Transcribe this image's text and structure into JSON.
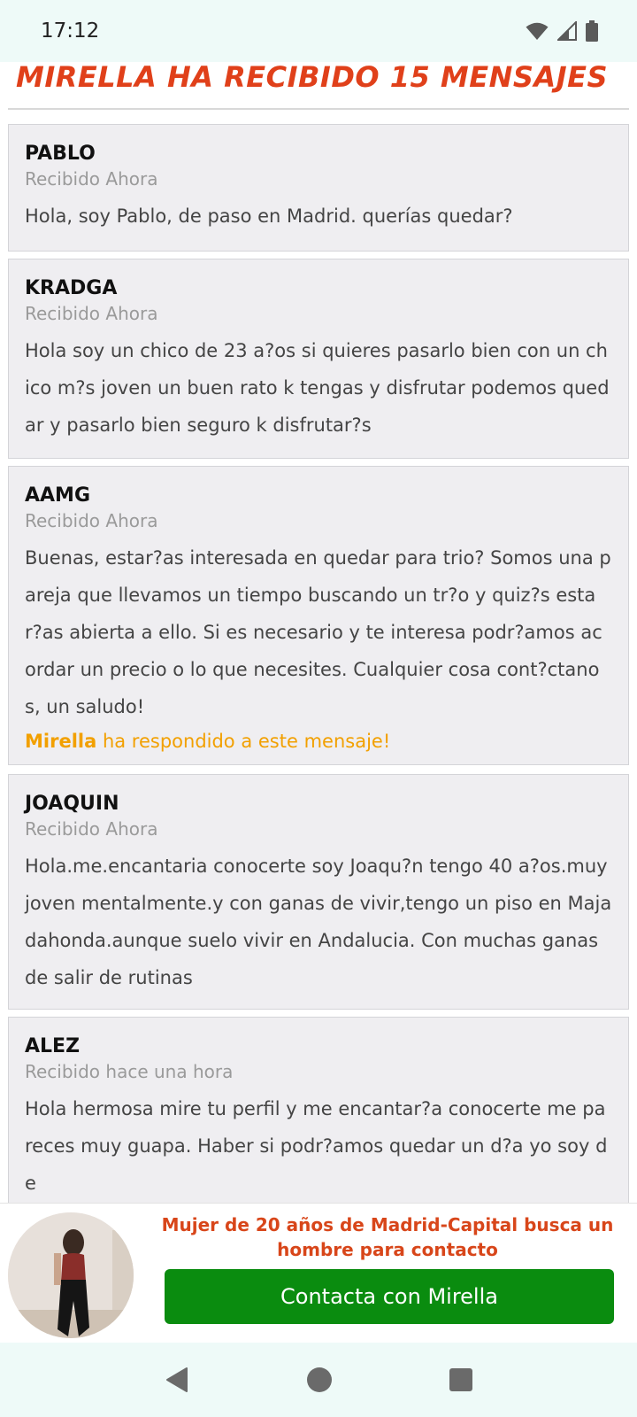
{
  "status_bar": {
    "time": "17:12"
  },
  "page": {
    "title": "Mirella ha recibido 15 mensajes"
  },
  "messages": [
    {
      "sender": "PABLO",
      "received": "Recibido Ahora",
      "body": "Hola, soy Pablo, de paso en Madrid. querías quedar?"
    },
    {
      "sender": "KRADGA",
      "received": "Recibido Ahora",
      "body": "Hola soy un chico de 23 a?os si quieres pasarlo bien con un chico m?s joven un buen rato k tengas y disfrutar podemos quedar y pasarlo bien seguro k disfrutar?s"
    },
    {
      "sender": "AAMG",
      "received": "Recibido Ahora",
      "body": "Buenas, estar?as interesada en quedar para trio? Somos una pareja que llevamos un tiempo buscando un tr?o y quiz?s estar?as abierta a ello. Si es necesario y te interesa podr?amos acordar un precio o lo que necesites. Cualquier cosa cont?ctanos, un saludo!",
      "reply_name": "Mirella",
      "reply_text": " ha respondido a este mensaje!"
    },
    {
      "sender": "JOAQUIN",
      "received": "Recibido Ahora",
      "body": "Hola.me.encantaria conocerte soy Joaqu?n tengo 40 a?os.muy joven mentalmente.y con ganas de vivir,tengo un piso en Majadahonda.aunque suelo vivir en Andalucia. Con muchas ganas de salir de rutinas"
    },
    {
      "sender": "ALEZ",
      "received": "Recibido hace una hora",
      "body": "Hola hermosa mire tu perfil y me encantar?a conocerte me pareces muy guapa. Haber si podr?amos quedar un d?a yo soy de"
    }
  ],
  "promo": {
    "headline": "Mujer de 20 años de Madrid-Capital busca un hombre para contacto",
    "button_label": "Contacta con Mirella"
  },
  "colors": {
    "title": "#e0401a",
    "reply": "#f2a000",
    "promo_text": "#d8461a",
    "button": "#0a8c0f"
  }
}
